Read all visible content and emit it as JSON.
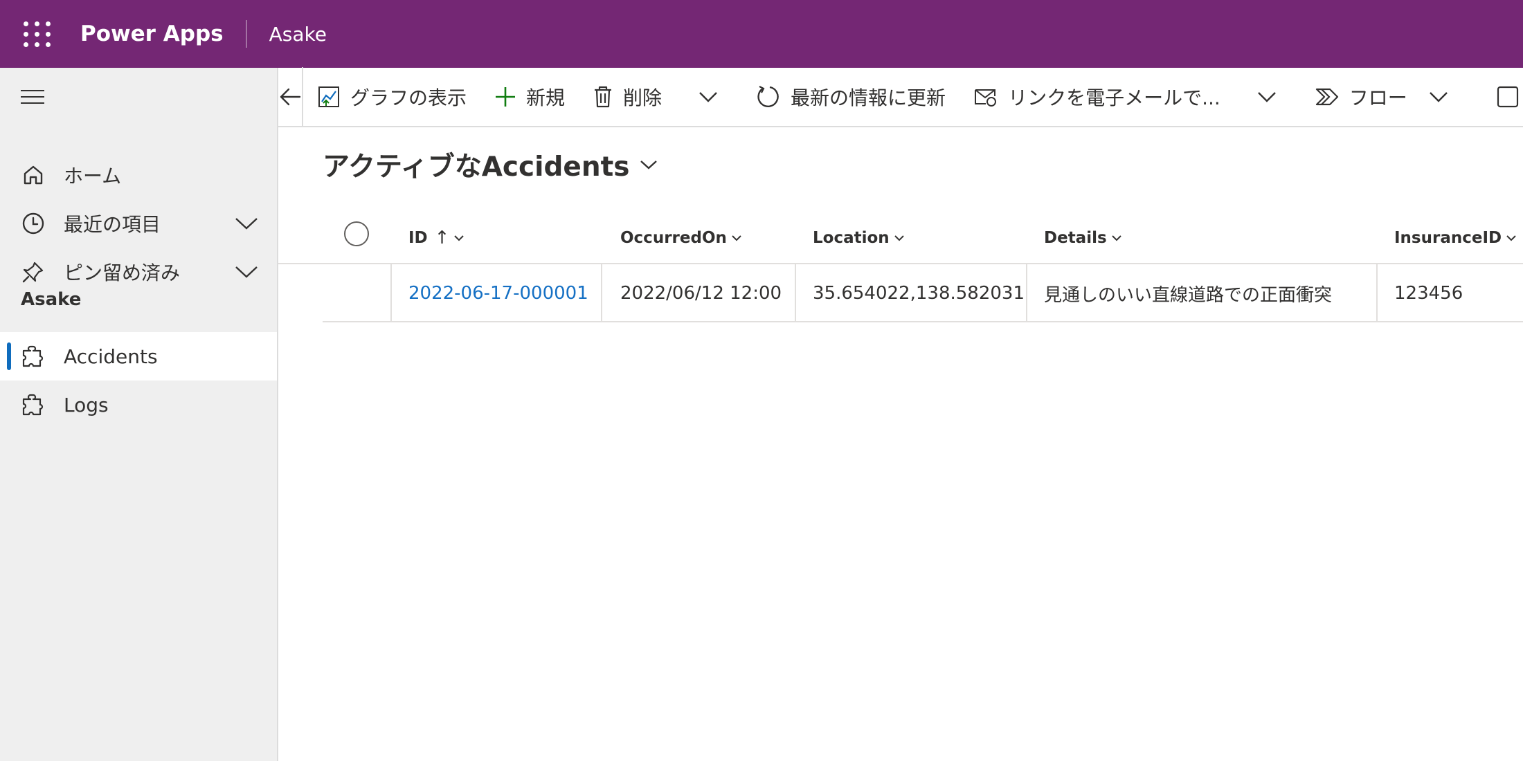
{
  "topbar": {
    "brand": "Power Apps",
    "environment": "Asake"
  },
  "sidebar": {
    "items": [
      {
        "label": "ホーム",
        "icon": "home-icon"
      },
      {
        "label": "最近の項目",
        "icon": "clock-icon"
      },
      {
        "label": "ピン留め済み",
        "icon": "pin-icon"
      }
    ],
    "section_label": "Asake",
    "entities": [
      {
        "label": "Accidents",
        "icon": "puzzle-icon",
        "active": true
      },
      {
        "label": "Logs",
        "icon": "puzzle-icon",
        "active": false
      }
    ]
  },
  "commandbar": {
    "show_chart": "グラフの表示",
    "new": "新規",
    "delete": "削除",
    "refresh": "最新の情報に更新",
    "email_link": "リンクを電子メールで...",
    "flow": "フロー"
  },
  "view": {
    "title": "アクティブなAccidents"
  },
  "grid": {
    "columns": [
      "ID",
      "OccurredOn",
      "Location",
      "Details",
      "InsuranceID"
    ],
    "sort_indicator": "↑",
    "rows": [
      {
        "id": "2022-06-17-000001",
        "occurred_on": "2022/06/12 12:00",
        "location": "35.654022,138.582031",
        "details": "見通しのいい直線道路での正面衝突",
        "insurance_id": "123456"
      }
    ]
  },
  "colors": {
    "header": "#742774",
    "link": "#1570c4",
    "accent_new": "#107c10",
    "active_indicator": "#0f6cbd"
  }
}
